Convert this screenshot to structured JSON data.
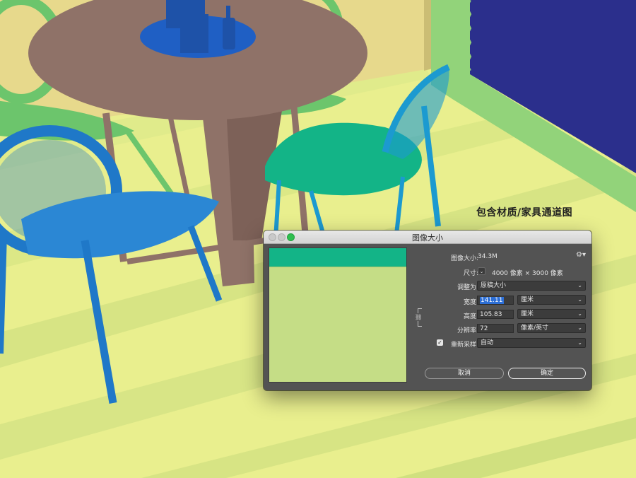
{
  "caption": "包含材质/家具通道图",
  "dialog": {
    "title": "图像大小",
    "image_size_label": "图像大小:",
    "image_size_value": "34.3M",
    "dimensions_label": "尺寸:",
    "dimensions_value": "4000 像素 × 3000 像素",
    "fit_to_label": "调整为:",
    "fit_to_value": "原稿大小",
    "width_label": "宽度:",
    "width_value": "141.11",
    "width_unit": "厘米",
    "height_label": "高度:",
    "height_value": "105.83",
    "height_unit": "厘米",
    "resolution_label": "分辨率:",
    "resolution_value": "72",
    "resolution_unit": "像素/英寸",
    "resample_label": "重新采样:",
    "resample_value": "自动",
    "cancel_label": "取消",
    "ok_label": "确定"
  },
  "colors": {
    "wall": "#e7d98c",
    "floor": "#e9ef8e",
    "night_window": "#2b2f8c",
    "table": "#8f7268",
    "tray": "#1f5fc4",
    "chair_blue": "#1f78c8",
    "chair_teal": "#13b487",
    "chair_green": "#6cc56c",
    "chair_cyan": "#1c9ad0"
  }
}
